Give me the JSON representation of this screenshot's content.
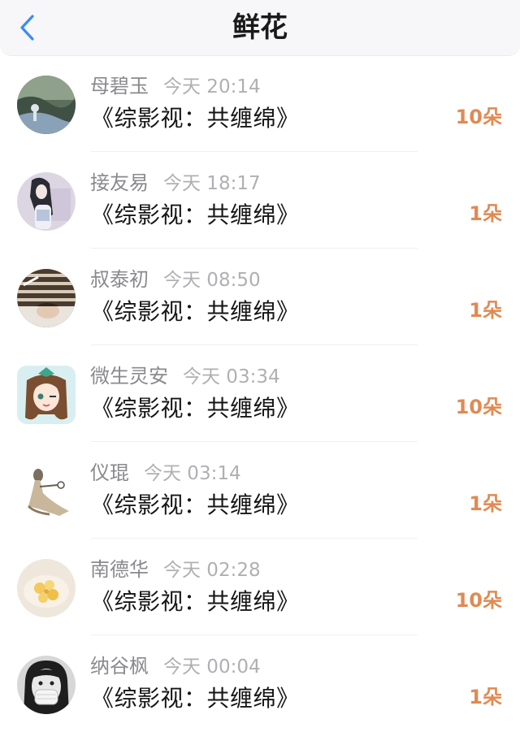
{
  "header": {
    "title": "鲜花"
  },
  "entries": [
    {
      "name": "母碧玉",
      "time": "今天 20:14",
      "work": "《综影视：共缠绵》",
      "amount": "10朵",
      "avatar": "forest-photo-avatar"
    },
    {
      "name": "接友易",
      "time": "今天 18:17",
      "work": "《综影视：共缠绵》",
      "amount": "1朵",
      "avatar": "anime-girl-avatar"
    },
    {
      "name": "叔泰初",
      "time": "今天 08:50",
      "work": "《综影视：共缠绵》",
      "amount": "1朵",
      "avatar": "sleeping-man-avatar"
    },
    {
      "name": "微生灵安",
      "time": "今天 03:34",
      "work": "《综影视：共缠绵》",
      "amount": "10朵",
      "avatar": "cartoon-girl-avatar"
    },
    {
      "name": "仪琨",
      "time": "今天 03:14",
      "work": "《综影视：共缠绵》",
      "amount": "1朵",
      "avatar": "ancient-figure-avatar"
    },
    {
      "name": "南德华",
      "time": "今天 02:28",
      "work": "《综影视：共缠绵》",
      "amount": "10朵",
      "avatar": "food-plate-avatar"
    },
    {
      "name": "纳谷枫",
      "time": "今天 00:04",
      "work": "《综影视：共缠绵》",
      "amount": "1朵",
      "avatar": "masked-girl-avatar"
    }
  ],
  "colors": {
    "accent": "#e08a52",
    "back_icon": "#3b8cf0"
  }
}
